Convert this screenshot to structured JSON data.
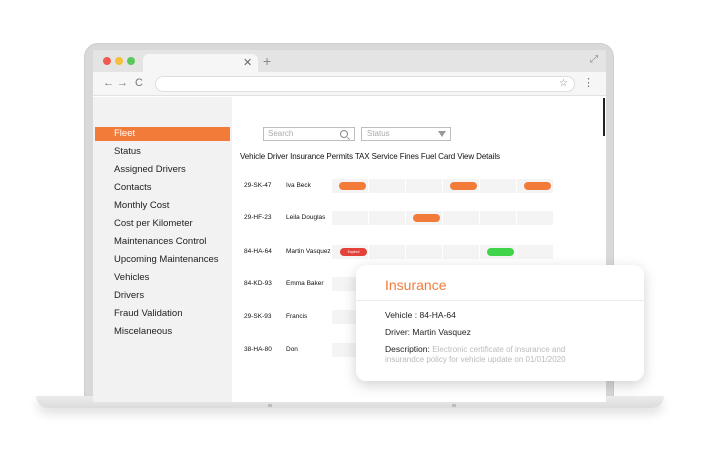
{
  "browser": {
    "tab_close": "✕",
    "new_tab": "+",
    "back": "←",
    "forward": "→",
    "reload": "C",
    "star": "☆",
    "menu": "⋮",
    "expand": "⤢"
  },
  "sidebar": {
    "items": [
      {
        "label": "Fleet",
        "active": true
      },
      {
        "label": "Status"
      },
      {
        "label": "Assigned Drivers"
      },
      {
        "label": "Contacts"
      },
      {
        "label": "Monthly Cost"
      },
      {
        "label": "Cost per Kilometer"
      },
      {
        "label": "Maintenances Control"
      },
      {
        "label": "Upcoming Maintenances"
      },
      {
        "label": "Vehicles"
      },
      {
        "label": "Drivers"
      },
      {
        "label": "Fraud Validation"
      },
      {
        "label": "Miscelaneous"
      }
    ]
  },
  "filters": {
    "search_placeholder": "Search",
    "status_placeholder": "Status"
  },
  "table": {
    "headers": "Vehicle Driver Insurance Permits TAX Service Fines Fuel Card View Details",
    "rows": [
      {
        "plate": "29-SK-47",
        "driver": "Iva Beck"
      },
      {
        "plate": "29-HF-23",
        "driver": "Leila Douglas"
      },
      {
        "plate": "84-HA-64",
        "driver": "Martin Vasquez",
        "badge": "Expired"
      },
      {
        "plate": "84-KD-93",
        "driver": "Emma Baker"
      },
      {
        "plate": "29-SK-93",
        "driver": "Francis"
      },
      {
        "plate": "38-HA-80",
        "driver": "Don"
      }
    ]
  },
  "popup": {
    "title": "Insurance",
    "vehicle": "Vehicle : 84-HA-64",
    "driver": "Driver: Martin Vasquez",
    "desc_label": "Description:",
    "desc_text_1": "Electronic certificate of insurance and",
    "desc_text_2": "insurandce policy for vehicle update on 01/01/2020"
  },
  "colors": {
    "accent": "#f37b3a",
    "expired": "#e3423a",
    "ok": "#3fd44a"
  }
}
